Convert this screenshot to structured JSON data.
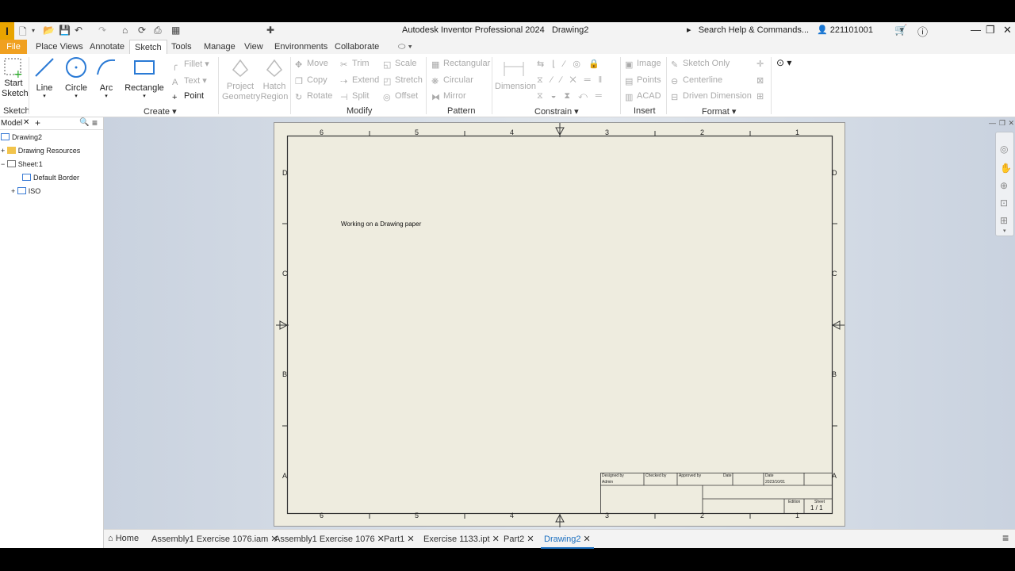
{
  "titlebar": {
    "app_letter": "I",
    "title": "Autodesk Inventor Professional 2024",
    "document": "Drawing2",
    "search_help": "Search Help & Commands...",
    "user": "221101001"
  },
  "menu": {
    "tabs": [
      "File",
      "Place Views",
      "Annotate",
      "Sketch",
      "Tools",
      "Manage",
      "View",
      "Environments",
      "Collaborate"
    ],
    "active": "Sketch"
  },
  "ribbon": {
    "start_sketch": "Start Sketch",
    "line": "Line",
    "circle": "Circle",
    "arc": "Arc",
    "rectangle": "Rectangle",
    "fillet": "Fillet",
    "text": "Text",
    "point": "Point",
    "project_geometry": "Project Geometry",
    "hatch_region": "Hatch Region",
    "move": "Move",
    "copy": "Copy",
    "rotate": "Rotate",
    "trim": "Trim",
    "extend": "Extend",
    "split": "Split",
    "scale": "Scale",
    "stretch": "Stretch",
    "offset": "Offset",
    "rectangular": "Rectangular",
    "circular": "Circular",
    "mirror": "Mirror",
    "dimension": "Dimension",
    "image": "Image",
    "points": "Points",
    "acad": "ACAD",
    "sketch_only": "Sketch Only",
    "centerline": "Centerline",
    "driven_dimension": "Driven Dimension",
    "panels": {
      "sketch": "Sketch",
      "create": "Create",
      "modify": "Modify",
      "pattern": "Pattern",
      "constrain": "Constrain",
      "insert": "Insert",
      "format": "Format"
    }
  },
  "browser": {
    "title": "Model",
    "items": [
      "Drawing2",
      "Drawing Resources",
      "Sheet:1",
      "Default Border",
      "ISO"
    ]
  },
  "sheet": {
    "note": "Working on a Drawing paper",
    "top_zones": [
      "6",
      "5",
      "4",
      "3",
      "2",
      "1"
    ],
    "side_zones": [
      "D",
      "C",
      "B",
      "A"
    ],
    "titleblock": {
      "designed_by_label": "Designed by",
      "checked_by_label": "Checked by",
      "approved_by_label": "Approved by",
      "date_label": "Date",
      "date_label2": "Date",
      "designed_by": "Admin",
      "date": "2023/10/01",
      "edition_label": "Edition",
      "sheet_label": "Sheet",
      "sheet_value": "1 / 1"
    }
  },
  "doc_tabs": {
    "home": "Home",
    "tabs": [
      "Assembly1 Exercise 1076.iam",
      "Assembly1 Exercise 1076",
      "Part1",
      "Exercise 1133.ipt",
      "Part2",
      "Drawing2"
    ],
    "active": "Drawing2"
  },
  "colors": {
    "accent": "#1a6fc0",
    "file_tab": "#f0a020",
    "paper": "#eeecdf"
  }
}
